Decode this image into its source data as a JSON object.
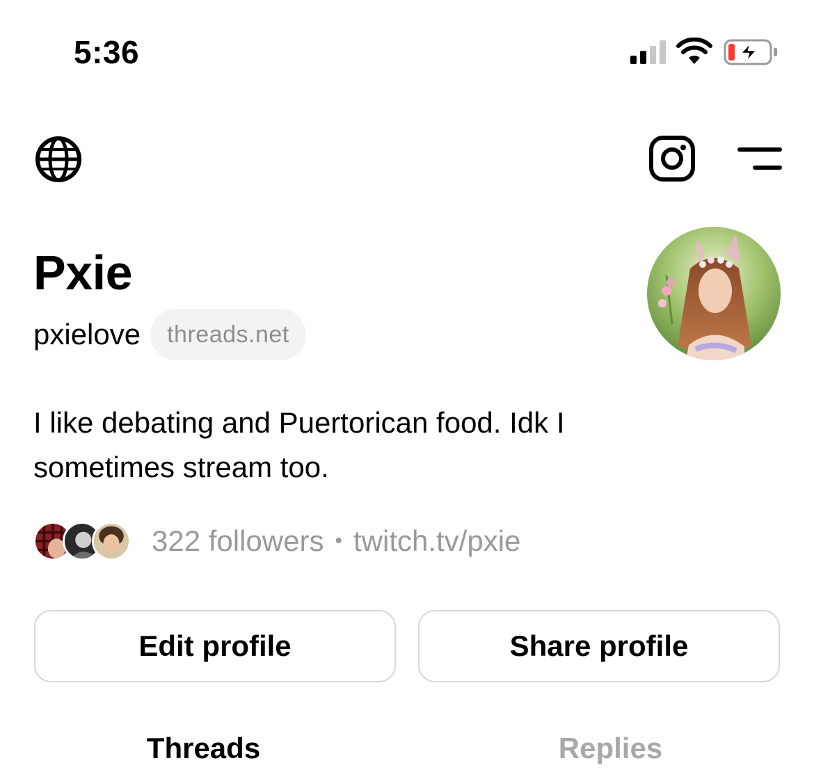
{
  "status_bar": {
    "time": "5:36"
  },
  "profile": {
    "name": "Pxie",
    "username": "pxielove",
    "domain_badge": "threads.net",
    "bio": "I like debating and Puertorican food. Idk I sometimes stream too.",
    "followers": "322 followers",
    "separator": "•",
    "link": "twitch.tv/pxie"
  },
  "actions": {
    "edit_label": "Edit profile",
    "share_label": "Share profile"
  },
  "tabs": [
    {
      "label": "Threads",
      "active": true
    },
    {
      "label": "Replies",
      "active": false
    }
  ],
  "icons": {
    "globe": "globe-icon",
    "instagram": "instagram-icon",
    "menu": "menu-icon"
  },
  "colors": {
    "text": "#000000",
    "muted": "#999999",
    "pill_bg": "#f3f3f3",
    "border": "#d8d8d8",
    "battery_low": "#ff3b30"
  }
}
